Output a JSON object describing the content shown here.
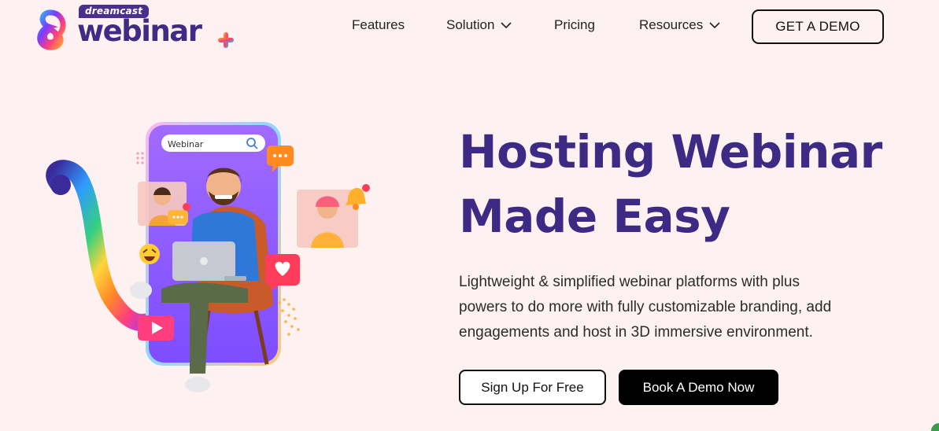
{
  "brand": {
    "sub_label": "dreamcast",
    "name": "webinar",
    "colors": {
      "primary": "#3d2a84",
      "background": "#fdf2f1"
    }
  },
  "nav": {
    "items": [
      {
        "label": "Features",
        "icon": ""
      },
      {
        "label": "Solution",
        "icon": "chevron-down-icon"
      },
      {
        "label": "Pricing",
        "icon": ""
      },
      {
        "label": "Resources",
        "icon": "chevron-down-icon"
      }
    ],
    "cta_label": "GET A DEMO"
  },
  "hero": {
    "illustration": {
      "search_text": "Webinar",
      "icons": [
        "search-icon",
        "chat-bubble-icon",
        "bell-icon",
        "heart-icon",
        "play-icon",
        "laughing-emoji-icon"
      ]
    },
    "title_line1": "Hosting Webinar",
    "title_line2": "Made Easy",
    "description_line1": "Lightweight & simplified webinar platforms with plus",
    "description_line2": "powers to do more with fully customizable branding, add",
    "description_line3": "engagements and host in 3D immersive environment.",
    "primary_button": "Sign Up For Free",
    "secondary_button": "Book A Demo Now"
  }
}
